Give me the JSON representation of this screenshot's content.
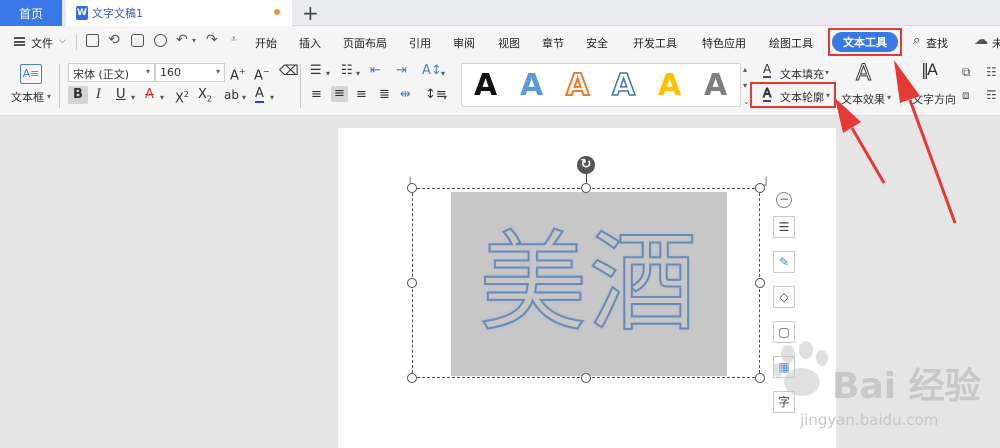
{
  "tabs": {
    "home": "首页",
    "document": "文字文稿1",
    "new_tab": "+"
  },
  "menu": {
    "file": "文件",
    "items": [
      "开始",
      "插入",
      "页面布局",
      "引用",
      "审阅",
      "视图",
      "章节",
      "安全",
      "开发工具",
      "特色应用",
      "绘图工具"
    ],
    "active": "文本工具",
    "search": "查找",
    "cloud_partial": "未"
  },
  "ribbon": {
    "textbox_label": "文本框",
    "font_name": "宋体 (正文)",
    "font_size": "160",
    "text_fill": "文本填充",
    "text_outline": "文本轮廓",
    "text_effect": "文本效果",
    "text_direction": "文字方向",
    "gallery_styles": [
      {
        "glyph": "A",
        "color": "#111111",
        "stroke": "#111111"
      },
      {
        "glyph": "A",
        "color": "#5b9bd5",
        "stroke": "#5b9bd5"
      },
      {
        "glyph": "A",
        "color": "#ffffff",
        "stroke": "#ed7d31"
      },
      {
        "glyph": "A",
        "color": "#ffffff",
        "stroke": "#4472c4"
      },
      {
        "glyph": "A",
        "color": "#ffc000",
        "stroke": "#ffc000"
      },
      {
        "glyph": "A",
        "color": "#7f7f7f",
        "stroke": "#7f7f7f"
      }
    ]
  },
  "document": {
    "text": "美酒"
  },
  "watermark": {
    "brand": "Bai 经验",
    "url": "jingyan.baidu.com"
  },
  "colors": {
    "accent": "#3b78e7",
    "highlight_box": "#e53935",
    "text_outline": "#6c8bb3"
  }
}
